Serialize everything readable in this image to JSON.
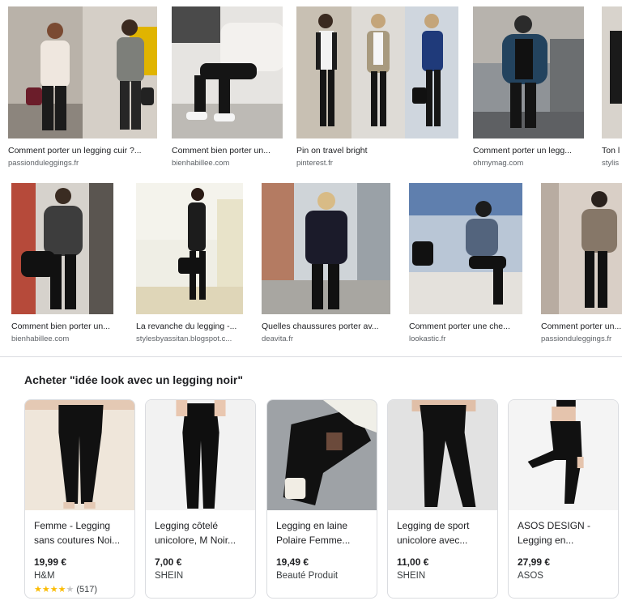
{
  "image_results_row1": [
    {
      "caption": "Comment porter un legging cuir ?...",
      "source": "passionduleggings.fr"
    },
    {
      "caption": "Comment bien porter un...",
      "source": "bienhabillee.com"
    },
    {
      "caption": "Pin on travel bright",
      "source": "pinterest.fr"
    },
    {
      "caption": "Comment porter un legg...",
      "source": "ohmymag.com"
    },
    {
      "caption": "Ton l",
      "source": "stylis"
    }
  ],
  "image_results_row2": [
    {
      "caption": "Comment bien porter un...",
      "source": "bienhabillee.com"
    },
    {
      "caption": "La revanche du legging -...",
      "source": "stylesbyassitan.blogspot.c..."
    },
    {
      "caption": "Quelles chaussures porter av...",
      "source": "deavita.fr"
    },
    {
      "caption": "Comment porter une che...",
      "source": "lookastic.fr"
    },
    {
      "caption": "Comment porter un...",
      "source": "passionduleggings.fr"
    }
  ],
  "shopping": {
    "title": "Acheter \"idée look avec un legging noir\"",
    "products": [
      {
        "name": "Femme - Legging sans coutures Noi...",
        "price": "19,99 €",
        "store": "H&M",
        "rating_stars": 4,
        "rating_count": "(517)"
      },
      {
        "name": "Legging côtelé unicolore, M Noir...",
        "price": "7,00 €",
        "store": "SHEIN"
      },
      {
        "name": "Legging en laine Polaire Femme...",
        "price": "19,49 €",
        "store": "Beauté Produit"
      },
      {
        "name": "Legging de sport unicolore avec...",
        "price": "11,00 €",
        "store": "SHEIN"
      },
      {
        "name": "ASOS DESIGN - Legging en...",
        "price": "27,99 €",
        "store": "ASOS"
      }
    ]
  },
  "colors": {
    "star": "#fbbc04",
    "legging": "#111111",
    "card_border": "#dadce0"
  }
}
